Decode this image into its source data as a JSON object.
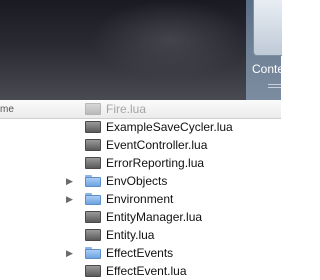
{
  "toolbar": {
    "right_label": "Conte"
  },
  "columns": {
    "name_header": "me",
    "faded_item": "Fire.lua"
  },
  "files": [
    {
      "name": "ExampleSaveCycler.lua",
      "type": "file",
      "expandable": false
    },
    {
      "name": "EventController.lua",
      "type": "file",
      "expandable": false
    },
    {
      "name": "ErrorReporting.lua",
      "type": "file",
      "expandable": false
    },
    {
      "name": "EnvObjects",
      "type": "folder",
      "expandable": true
    },
    {
      "name": "Environment",
      "type": "folder",
      "expandable": true
    },
    {
      "name": "EntityManager.lua",
      "type": "file",
      "expandable": false
    },
    {
      "name": "Entity.lua",
      "type": "file",
      "expandable": false
    },
    {
      "name": "EffectEvents",
      "type": "folder",
      "expandable": true
    },
    {
      "name": "EffectEvent.lua",
      "type": "file",
      "expandable": false
    }
  ],
  "icons": {
    "file": "lua-file-icon",
    "folder": "folder-icon",
    "expand": "disclosure-triangle-icon"
  }
}
